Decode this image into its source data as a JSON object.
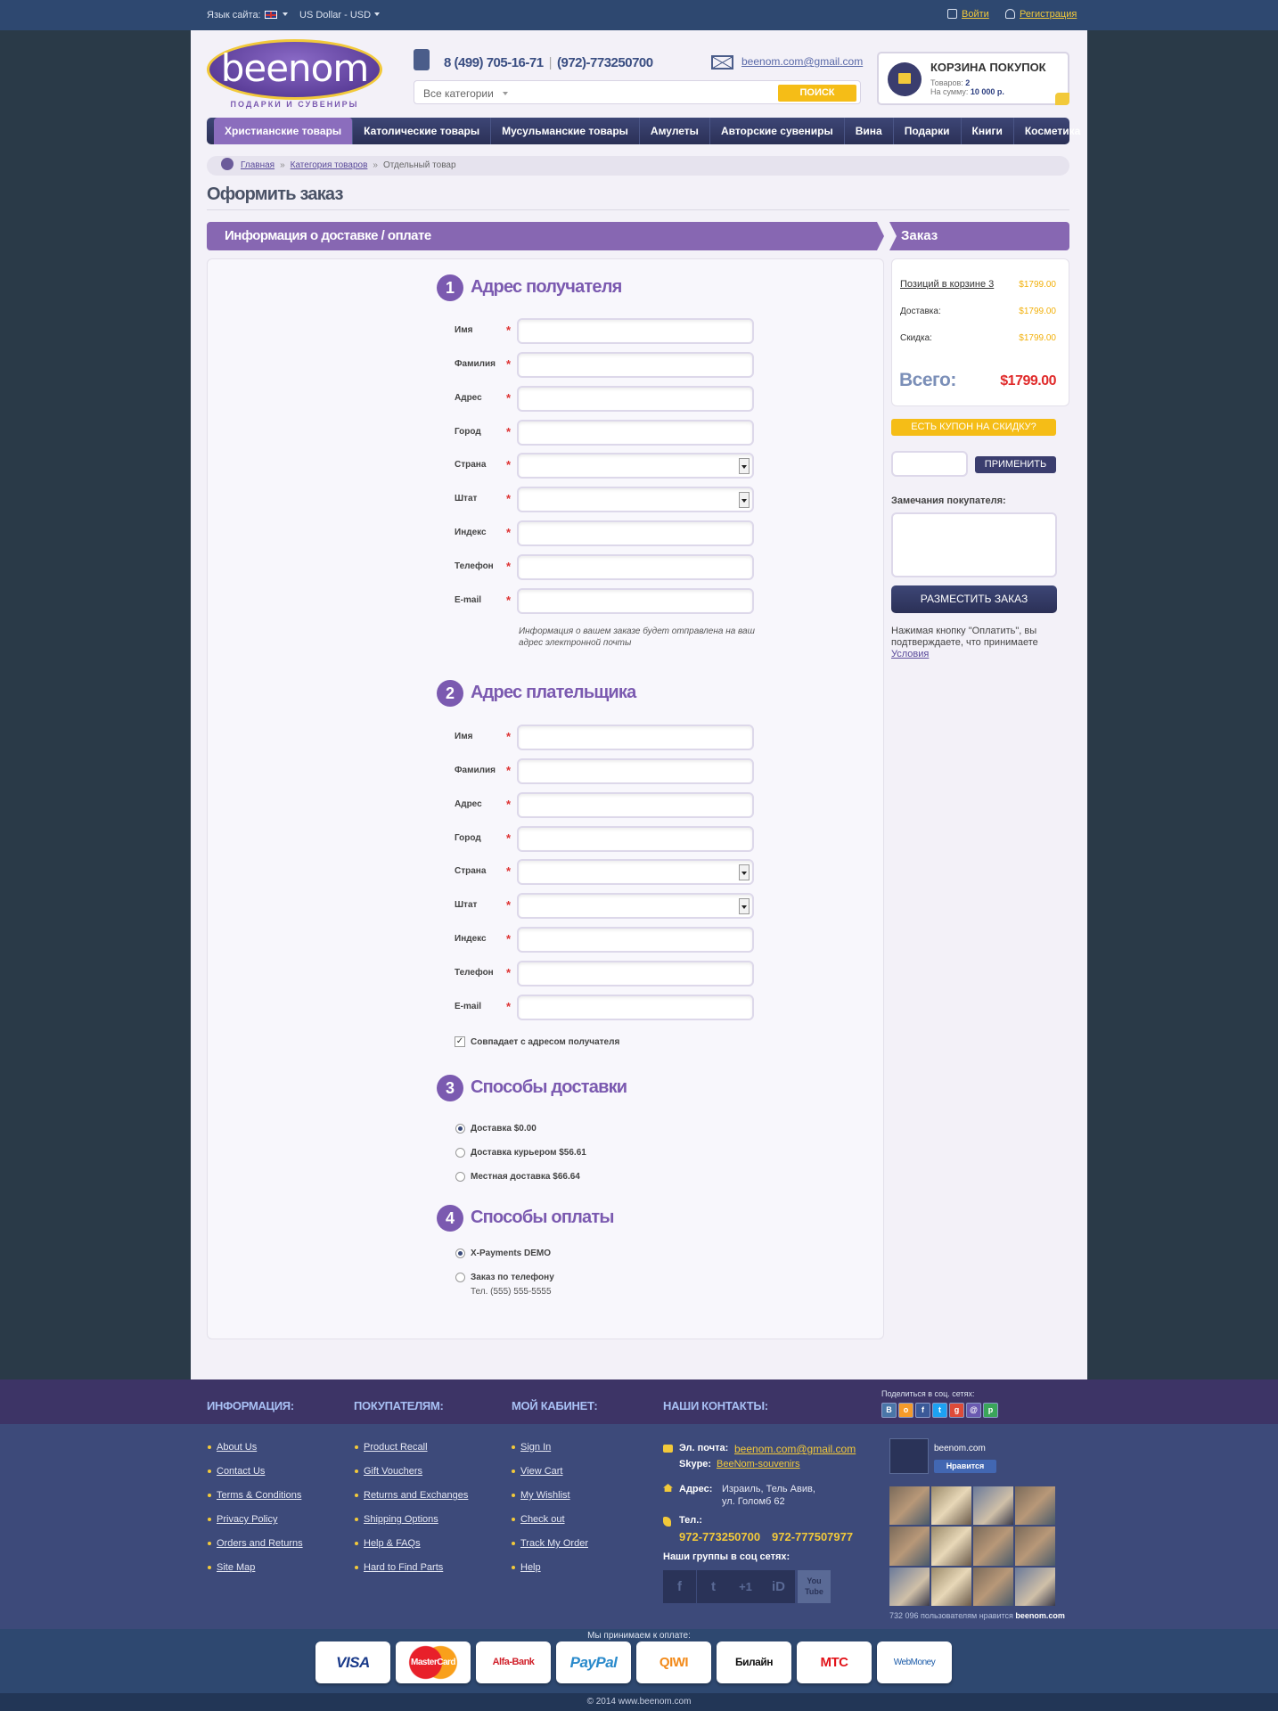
{
  "topbar": {
    "lang_label": "Язык сайта:",
    "currency": "US Dollar - USD",
    "login": "Войти",
    "register": "Регистрация"
  },
  "header": {
    "logo_text": "beenom",
    "logo_sub": "ПОДАРКИ И СУВЕНИРЫ",
    "phone1": "8 (499) 705-16-71",
    "phone2": "(972)-773250700",
    "email": "beenom.com@gmail.com",
    "search_category": "Все категории",
    "search_button": "ПОИСК",
    "cart_title": "КОРЗИНА ПОКУПОК",
    "cart_items_label": "Товаров:",
    "cart_items_value": "2",
    "cart_sum_label": "На сумму:",
    "cart_sum_value": "10 000 р."
  },
  "nav": [
    "Христианские товары",
    "Католические товары",
    "Мусульманские товары",
    "Амулеты",
    "Авторские сувениры",
    "Вина",
    "Подарки",
    "Книги",
    "Косметика"
  ],
  "breadcrumb": [
    "Главная",
    "Категория товаров",
    "Отдельный товар"
  ],
  "page_title": "Оформить заказ",
  "section_left": "Информация о доставке / оплате",
  "section_right": "Заказ",
  "steps": {
    "s1": {
      "num": "1",
      "title": "Адрес получателя"
    },
    "s2": {
      "num": "2",
      "title": "Адрес плательщика"
    },
    "s3": {
      "num": "3",
      "title": "Способы доставки"
    },
    "s4": {
      "num": "4",
      "title": "Способы оплаты"
    }
  },
  "fields": [
    "Имя",
    "Фамилия",
    "Адрес",
    "Город",
    "Страна",
    "Штат",
    "Индекс",
    "Телефон",
    "E-mail"
  ],
  "required_mark": "*",
  "email_note": "Информация о вашем заказе будет отправлена на ваш адрес электронной почты",
  "same_address": "Совпадает с адресом получателя",
  "delivery": [
    {
      "label": "Доставка $0.00",
      "selected": true
    },
    {
      "label": "Доставка курьером $56.61",
      "selected": false
    },
    {
      "label": "Местная доставка $66.64",
      "selected": false
    }
  ],
  "payment": [
    {
      "label": "X-Payments DEMO",
      "selected": true
    },
    {
      "label": "Заказ по телефону",
      "selected": false
    }
  ],
  "payment_phone": "Тел. (555) 555-5555",
  "summary": {
    "items_label": "Позиций в корзине 3",
    "items_value": "$1799.00",
    "delivery_label": "Доставка:",
    "delivery_value": "$1799.00",
    "discount_label": "Скидка:",
    "discount_value": "$1799.00",
    "total_label": "Всего:",
    "total_value": "$1799.00"
  },
  "coupon_button": "ЕСТЬ КУПОН НА СКИДКУ?",
  "apply_button": "ПРИМЕНИТЬ",
  "remarks_label": "Замечания покупателя:",
  "order_button": "РАЗМЕСТИТЬ ЗАКАЗ",
  "terms_text": "Нажимая кнопку \"Оплатить\", вы подтверждаете, что принимаете",
  "terms_link": "Условия",
  "footer": {
    "info_title": "ИНФОРМАЦИЯ:",
    "info": [
      "About Us",
      "Contact Us",
      "Terms & Conditions",
      "Privacy Policy",
      "Orders and Returns",
      "Site Map"
    ],
    "buyers_title": "ПОКУПАТЕЛЯМ:",
    "buyers": [
      "Product Recall",
      "Gift Vouchers",
      "Returns and Exchanges",
      "Shipping Options",
      "Help & FAQs",
      "Hard to Find Parts"
    ],
    "cabinet_title": "МОЙ КАБИНЕТ:",
    "cabinet": [
      "Sign In",
      "View Cart",
      "My Wishlist",
      "Check out",
      "Track My Order",
      "Help"
    ],
    "contacts_title": "НАШИ КОНТАКТЫ:",
    "email_label": "Эл. почта:",
    "email_value": "beenom.com@gmail.com",
    "skype_label": "Skype:",
    "skype_value": "BeeNom-souvenirs",
    "address_label": "Адрес:",
    "address_line1": "Израиль, Тель Авив,",
    "address_line2": "ул. Голомб 62",
    "phone_label": "Тел.:",
    "phone1": "972-773250700",
    "phone2": "972-777507977",
    "groups_title": "Наши группы в соц сетях:",
    "social": [
      "f",
      "t",
      "+1",
      "iD",
      "You Tube"
    ],
    "share_label": "Поделиться в соц. сетях:",
    "share": [
      "B",
      "o",
      "f",
      "t",
      "g",
      "@",
      "p"
    ],
    "fb_name": "beenom.com",
    "fb_like": "Нравится",
    "likes_count": "732 096 пользователям нравится",
    "likes_site": "beenom.com",
    "pay_label": "Мы принимаем к оплате:",
    "pay_methods": [
      "VISA",
      "MasterCard",
      "Alfa-Bank",
      "PayPal",
      "QIWI",
      "Билайн",
      "МТС",
      "WebMoney"
    ],
    "copyright": "© 2014 www.beenom.com"
  }
}
